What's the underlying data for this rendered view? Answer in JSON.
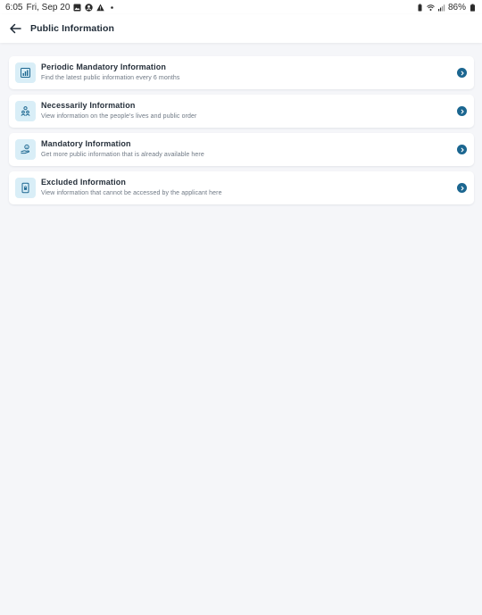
{
  "status_bar": {
    "time": "6:05",
    "date": "Fri, Sep 20",
    "battery": "86%"
  },
  "header": {
    "title": "Public Information",
    "back_icon": "arrow-left-icon"
  },
  "items": [
    {
      "title": "Periodic Mandatory Information",
      "description": "Find the latest public information every 6 months",
      "icon": "chart-report-icon"
    },
    {
      "title": "Necessarily Information",
      "description": "View information on the people's lives and public order",
      "icon": "people-icon"
    },
    {
      "title": "Mandatory Information",
      "description": "Get more public information that is already available here",
      "icon": "hand-info-icon"
    },
    {
      "title": "Excluded Information",
      "description": "View information that cannot be accessed by the applicant here",
      "icon": "locked-document-icon"
    }
  ],
  "colors": {
    "accent": "#1b6690",
    "icon_bg": "#d9eef7",
    "background": "#f5f6f9"
  }
}
